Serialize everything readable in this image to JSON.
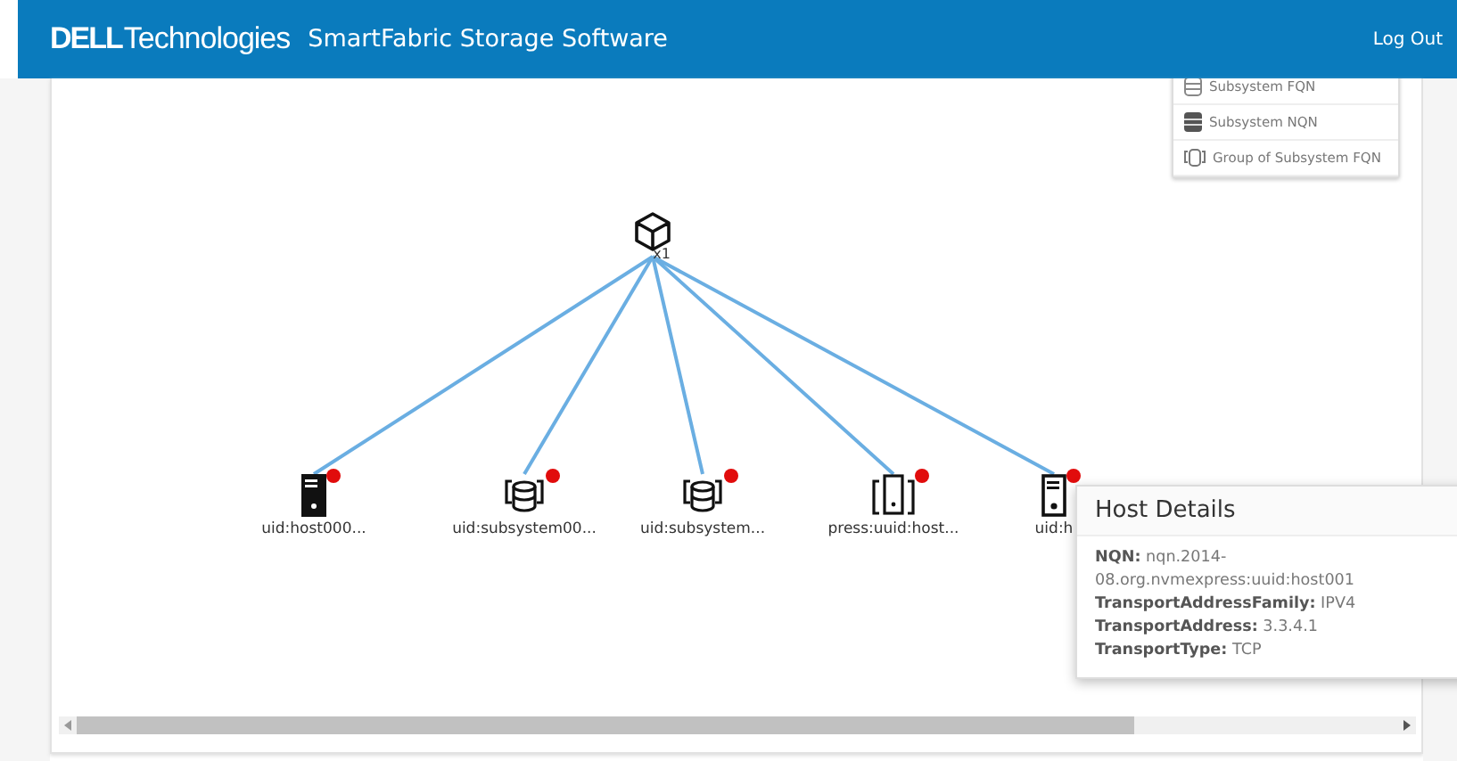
{
  "header": {
    "mark": "DELL",
    "brand": "Technologies",
    "title": "SmartFabric Storage Software",
    "logout": "Log Out"
  },
  "legend": [
    {
      "kind": "subsystem-fqn",
      "label": "Subsystem FQN"
    },
    {
      "kind": "subsystem-nqn",
      "label": "Subsystem NQN"
    },
    {
      "kind": "group",
      "label": "Group of Subsystem FQN"
    }
  ],
  "root": {
    "kind": "cube",
    "label": "x1"
  },
  "nodes": [
    {
      "kind": "host-filled",
      "label": "uid:host000...",
      "alert": true
    },
    {
      "kind": "subsystem",
      "label": "uid:subsystem00...",
      "alert": true
    },
    {
      "kind": "subsystem",
      "label": "uid:subsystem...",
      "alert": true
    },
    {
      "kind": "device",
      "label": "press:uuid:host...",
      "alert": true
    },
    {
      "kind": "host-outline",
      "label": "uid:h",
      "alert": true
    }
  ],
  "tooltip": {
    "title": "Host Details",
    "fields": [
      {
        "label": "NQN:",
        "value": "nqn.2014-08.org.nvmexpress:uuid:host001"
      },
      {
        "label": "TransportAddressFamily:",
        "value": "IPV4"
      },
      {
        "label": "TransportAddress:",
        "value": "3.3.4.1"
      },
      {
        "label": "TransportType:",
        "value": "TCP"
      }
    ]
  }
}
